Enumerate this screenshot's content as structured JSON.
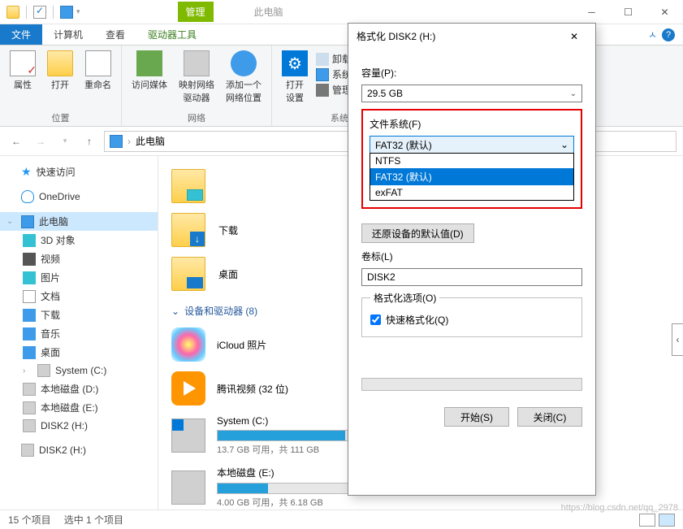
{
  "titlebar": {
    "contextual_tab": "管理",
    "location_tab": "此电脑"
  },
  "ribbon_tabs": {
    "file": "文件",
    "computer": "计算机",
    "view": "查看",
    "drive_tools": "驱动器工具"
  },
  "ribbon": {
    "group_location": "位置",
    "group_network": "网络",
    "group_system": "系统",
    "btn_properties": "属性",
    "btn_open": "打开",
    "btn_rename": "重命名",
    "btn_access_media": "访问媒体",
    "btn_map_drive": "映射网络\n驱动器",
    "btn_add_netloc": "添加一个\n网络位置",
    "btn_open_settings": "打开\n设置",
    "small_uninstall": "卸载或更改程序",
    "small_sysprops": "系统属性",
    "small_manage": "管理"
  },
  "breadcrumb": {
    "location": "此电脑"
  },
  "sidebar": {
    "quick_access": "快速访问",
    "onedrive": "OneDrive",
    "thispc": "此电脑",
    "items": [
      {
        "label": "3D 对象"
      },
      {
        "label": "视频"
      },
      {
        "label": "图片"
      },
      {
        "label": "文档"
      },
      {
        "label": "下载"
      },
      {
        "label": "音乐"
      },
      {
        "label": "桌面"
      },
      {
        "label": "System (C:)"
      },
      {
        "label": "本地磁盘 (D:)"
      },
      {
        "label": "本地磁盘 (E:)"
      },
      {
        "label": "DISK2 (H:)"
      },
      {
        "label": "DISK2 (H:)"
      }
    ]
  },
  "content": {
    "folders": [
      {
        "label": ""
      },
      {
        "label": "下载"
      },
      {
        "label": "桌面"
      }
    ],
    "section_devices": "设备和驱动器 (8)",
    "devices": [
      {
        "name": "iCloud 照片",
        "type": "app"
      },
      {
        "name": "腾讯视频 (32 位)",
        "type": "app"
      },
      {
        "name": "System (C:)",
        "type": "drive",
        "fill": 88,
        "sub": "13.7 GB 可用，共 111 GB"
      },
      {
        "name": "本地磁盘 (E:)",
        "type": "drive",
        "fill": 35,
        "sub": "4.00 GB 可用，共 6.18 GB"
      }
    ]
  },
  "statusbar": {
    "items_count": "15 个项目",
    "selected": "选中 1 个项目"
  },
  "dialog": {
    "title": "格式化 DISK2 (H:)",
    "capacity_label": "容量(P):",
    "capacity_value": "29.5 GB",
    "filesystem_label": "文件系统(F)",
    "filesystem_value": "FAT32 (默认)",
    "filesystem_options": [
      "NTFS",
      "FAT32 (默认)",
      "exFAT"
    ],
    "alloc_hidden": "",
    "restore_defaults": "还原设备的默认值(D)",
    "volume_label_label": "卷标(L)",
    "volume_label_value": "DISK2",
    "format_options_label": "格式化选项(O)",
    "quick_format": "快速格式化(Q)",
    "btn_start": "开始(S)",
    "btn_close": "关闭(C)"
  },
  "watermark": "https://blog.csdn.net/qq_2978"
}
